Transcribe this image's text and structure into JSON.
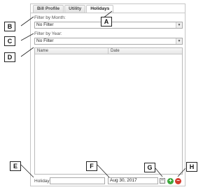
{
  "tabs": [
    {
      "label": "Bill Profile",
      "active": false
    },
    {
      "label": "Utility",
      "active": false
    },
    {
      "label": "Holidays",
      "active": true
    }
  ],
  "filter_month": {
    "label": "Filter by Month:",
    "value": "No Filter"
  },
  "filter_year": {
    "label": "Filter by Year:",
    "value": "No Filter"
  },
  "grid": {
    "columns": [
      "Name",
      "Date"
    ],
    "rows": []
  },
  "holiday_form": {
    "label": "Holiday:",
    "value": "",
    "date_value": "Aug 30, 2017"
  },
  "callouts": [
    "A",
    "B",
    "C",
    "D",
    "E",
    "F",
    "G",
    "H"
  ],
  "icons": {
    "calendar": "calendar-icon",
    "add": "add-icon",
    "delete": "delete-icon",
    "dropdown": "chevron-down-icon"
  },
  "colors": {
    "add": "#3ca83c",
    "delete": "#d43b2e"
  }
}
